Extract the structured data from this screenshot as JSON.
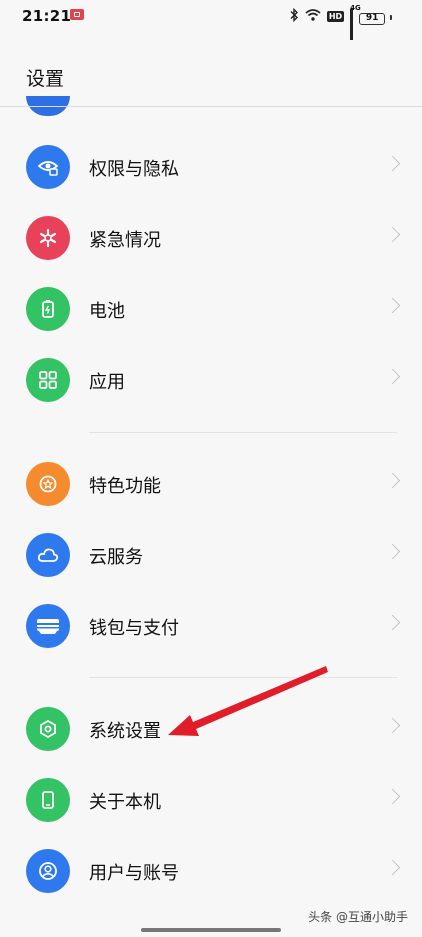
{
  "status_bar": {
    "time": "21:21",
    "network_tag": "4G",
    "battery": "91"
  },
  "header": {
    "title": "设置"
  },
  "settings_groups": [
    {
      "items": [
        {
          "label": "权限与隐私",
          "icon": "eye-lock-icon",
          "color": "#2f79ee"
        },
        {
          "label": "紧急情况",
          "icon": "asterisk-icon",
          "color": "#e8425a"
        },
        {
          "label": "电池",
          "icon": "battery-icon",
          "color": "#33c364"
        },
        {
          "label": "应用",
          "icon": "apps-grid-icon",
          "color": "#33c364"
        }
      ]
    },
    {
      "items": [
        {
          "label": "特色功能",
          "icon": "star-icon",
          "color": "#f58a2e"
        },
        {
          "label": "云服务",
          "icon": "cloud-icon",
          "color": "#2f79ee"
        },
        {
          "label": "钱包与支付",
          "icon": "wallet-icon",
          "color": "#2f79ee"
        }
      ]
    },
    {
      "items": [
        {
          "label": "系统设置",
          "icon": "hexagon-settings-icon",
          "color": "#33c364"
        },
        {
          "label": "关于本机",
          "icon": "phone-icon",
          "color": "#33c364"
        },
        {
          "label": "用户与账号",
          "icon": "user-icon",
          "color": "#2f79ee"
        }
      ]
    }
  ],
  "annotation": {
    "arrow_color": "#e11d2a",
    "points_to": "系统设置"
  },
  "watermark": {
    "text": "头条 @互通小助手"
  }
}
